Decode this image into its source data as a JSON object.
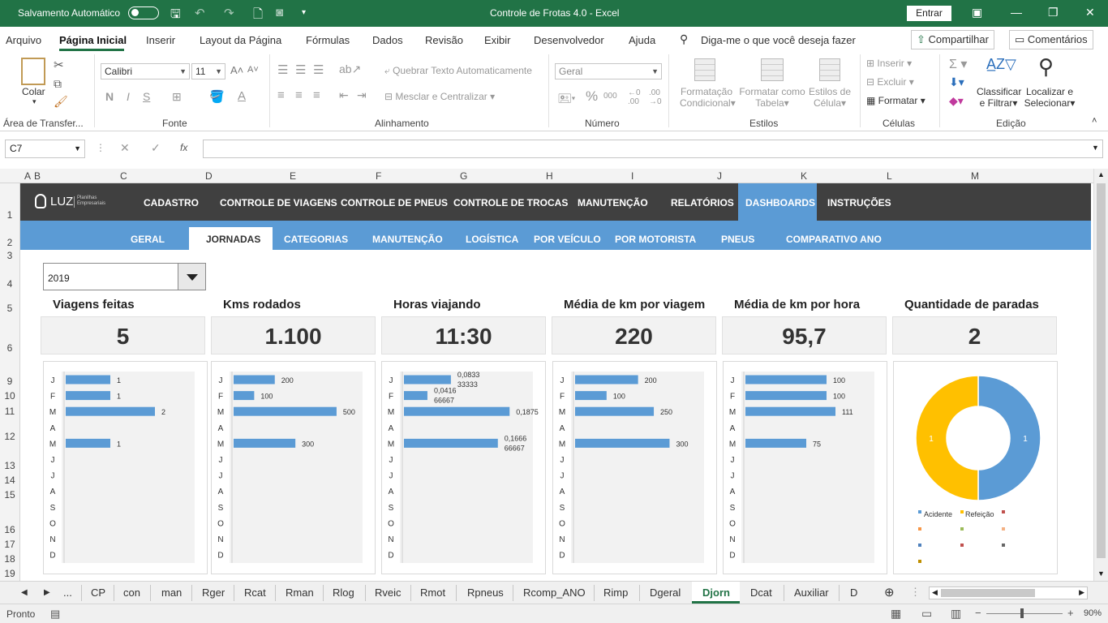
{
  "titlebar": {
    "autosave_label": "Salvamento Automático",
    "title": "Controle de Frotas 4.0  -  Excel",
    "entrar_label": "Entrar"
  },
  "menu": {
    "items": [
      "Arquivo",
      "Página Inicial",
      "Inserir",
      "Layout da Página",
      "Fórmulas",
      "Dados",
      "Revisão",
      "Exibir",
      "Desenvolvedor",
      "Ajuda"
    ],
    "tell_me": "Diga-me o que você deseja fazer",
    "share": "Compartilhar",
    "comments": "Comentários"
  },
  "ribbon": {
    "clipboard": {
      "paste": "Colar",
      "group": "Área de Transfer..."
    },
    "font": {
      "name": "Calibri",
      "size": "11",
      "bold": "N",
      "italic": "I",
      "underline": "S",
      "group": "Fonte"
    },
    "alignment": {
      "wrap": "Quebrar Texto Automaticamente",
      "merge": "Mesclar e Centralizar",
      "group": "Alinhamento"
    },
    "number": {
      "format": "Geral",
      "group": "Número",
      "percent": "%",
      "thousands": "000"
    },
    "styles": {
      "cond": [
        "Formatação",
        "Condicional"
      ],
      "table": [
        "Formatar como",
        "Tabela"
      ],
      "cell": [
        "Estilos de",
        "Célula"
      ],
      "group": "Estilos"
    },
    "cells": {
      "insert": "Inserir",
      "delete": "Excluir",
      "format": "Formatar",
      "group": "Células"
    },
    "editing": {
      "sort": [
        "Classificar",
        "e Filtrar"
      ],
      "find": [
        "Localizar e",
        "Selecionar"
      ],
      "group": "Edição"
    }
  },
  "formula": {
    "namebox": "C7",
    "fx": "fx"
  },
  "columns": [
    "A",
    "B",
    "C",
    "D",
    "E",
    "F",
    "G",
    "H",
    "I",
    "J",
    "K",
    "L",
    "M"
  ],
  "rows": [
    "1",
    "2",
    "3",
    "4",
    "5",
    "6",
    "9",
    "10",
    "11",
    "12",
    "13",
    "14",
    "15",
    "16",
    "17",
    "18",
    "19"
  ],
  "dashboard": {
    "logo": "LUZ",
    "logo_sub1": "Planilhas",
    "logo_sub2": "Empresariais",
    "nav_main": [
      "CADASTRO",
      "CONTROLE DE VIAGENS",
      "CONTROLE DE PNEUS",
      "CONTROLE DE TROCAS",
      "MANUTENÇÃO",
      "RELATÓRIOS",
      "DASHBOARDS",
      "INSTRUÇÕES"
    ],
    "nav_sub": [
      "GERAL",
      "JORNADAS",
      "CATEGORIAS",
      "MANUTENÇÃO",
      "LOGÍSTICA",
      "POR VEÍCULO",
      "POR MOTORISTA",
      "PNEUS",
      "COMPARATIVO ANO"
    ],
    "year": "2019",
    "kpis": [
      {
        "label": "Viagens feitas",
        "value": "5"
      },
      {
        "label": "Kms rodados",
        "value": "1.100"
      },
      {
        "label": "Horas viajando",
        "value": "11:30"
      },
      {
        "label": "Média de km por viagem",
        "value": "220"
      },
      {
        "label": "Média de km por hora",
        "value": "95,7"
      },
      {
        "label": "Quantidade de paradas",
        "value": "2"
      }
    ]
  },
  "chart_data": [
    {
      "type": "bar",
      "categories": [
        "J",
        "F",
        "M",
        "A",
        "M",
        "J",
        "J",
        "A",
        "S",
        "O",
        "N",
        "D"
      ],
      "values": [
        1,
        1,
        2,
        null,
        1,
        null,
        null,
        null,
        null,
        null,
        null,
        null
      ],
      "labels": [
        "1",
        "1",
        "2",
        "",
        "1",
        "",
        "",
        "",
        "",
        "",
        "",
        ""
      ],
      "xlim": [
        0,
        2.4
      ]
    },
    {
      "type": "bar",
      "categories": [
        "J",
        "F",
        "M",
        "A",
        "M",
        "J",
        "J",
        "A",
        "S",
        "O",
        "N",
        "D"
      ],
      "values": [
        200,
        100,
        500,
        null,
        300,
        null,
        null,
        null,
        null,
        null,
        null,
        null
      ],
      "labels": [
        "200",
        "100",
        "500",
        "",
        "300",
        "",
        "",
        "",
        "",
        "",
        "",
        ""
      ],
      "xlim": [
        0,
        520
      ]
    },
    {
      "type": "bar",
      "categories": [
        "J",
        "F",
        "M",
        "A",
        "M",
        "J",
        "J",
        "A",
        "S",
        "O",
        "N",
        "D"
      ],
      "values": [
        0.083333333,
        0.041666667,
        0.1875,
        null,
        0.166666667,
        null,
        null,
        null,
        null,
        null,
        null,
        null
      ],
      "labels": [
        "0,0833 33333",
        "0,0416 66667",
        "0,1875",
        "",
        "0,1666 66667",
        "",
        "",
        "",
        "",
        "",
        "",
        ""
      ],
      "xlim": [
        0,
        0.19
      ]
    },
    {
      "type": "bar",
      "categories": [
        "J",
        "F",
        "M",
        "A",
        "M",
        "J",
        "J",
        "A",
        "S",
        "O",
        "N",
        "D"
      ],
      "values": [
        200,
        100,
        250,
        null,
        300,
        null,
        null,
        null,
        null,
        null,
        null,
        null
      ],
      "labels": [
        "200",
        "100",
        "250",
        "",
        "300",
        "",
        "",
        "",
        "",
        "",
        "",
        ""
      ],
      "xlim": [
        0,
        340
      ]
    },
    {
      "type": "bar",
      "categories": [
        "J",
        "F",
        "M",
        "A",
        "M",
        "J",
        "J",
        "A",
        "S",
        "O",
        "N",
        "D"
      ],
      "values": [
        100,
        100,
        111,
        null,
        75,
        null,
        null,
        null,
        null,
        null,
        null,
        null
      ],
      "labels": [
        "100",
        "100",
        "111",
        "",
        "75",
        "",
        "",
        "",
        "",
        "",
        "",
        ""
      ],
      "xlim": [
        0,
        132
      ]
    },
    {
      "type": "pie",
      "categories": [
        "Acidente",
        "Refeição"
      ],
      "values": [
        1,
        1
      ],
      "labels": [
        "1",
        "1"
      ],
      "colors": [
        "#5b9bd5",
        "#ffc000"
      ]
    }
  ],
  "legend_colors": [
    "#5b9bd5",
    "#ffc000",
    "#c0504d",
    "#f79646",
    "#9bbb59",
    "#f4b183",
    "#4f81bd",
    "#c0504d",
    "#666666",
    "#bf8f00"
  ],
  "colors": {
    "excel_green": "#217346",
    "bar": "#5b9bd5",
    "nav_dark": "#404040",
    "nav_blue": "#5b9bd5"
  },
  "sheets": [
    "...",
    "CP",
    "con",
    "man",
    "Rger",
    "Rcat",
    "Rman",
    "Rlog",
    "Rveic",
    "Rmot",
    "Rpneus",
    "Rcomp_ANO",
    "Rimp",
    "Dgeral",
    "Djorn",
    "Dcat",
    "Auxiliar",
    "D"
  ],
  "active_sheet": "Djorn",
  "status": {
    "ready": "Pronto",
    "zoom": "90%"
  }
}
